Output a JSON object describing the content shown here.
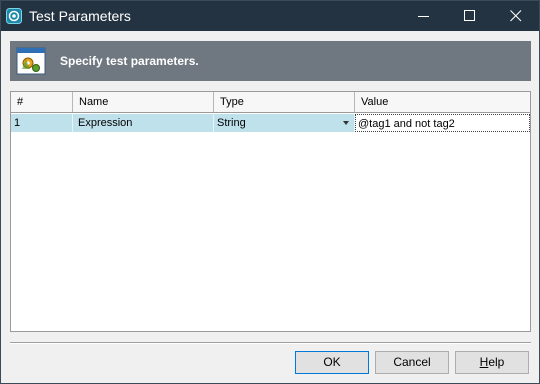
{
  "window": {
    "title": "Test Parameters"
  },
  "titlebar_controls": {
    "minimize_icon": "minimize-icon",
    "maximize_icon": "maximize-icon",
    "close_icon": "close-icon"
  },
  "banner": {
    "text": "Specify test parameters.",
    "icon": "parameters-icon"
  },
  "grid": {
    "columns": [
      "#",
      "Name",
      "Type",
      "Value"
    ],
    "rows": [
      {
        "num": "1",
        "name": "Expression",
        "type": "String",
        "value": "@tag1 and not tag2"
      }
    ]
  },
  "buttons": {
    "ok": "OK",
    "cancel": "Cancel",
    "help_first": "H",
    "help_rest": "elp"
  },
  "colors": {
    "titlebar": "#243342",
    "banner": "#6f7880",
    "row_highlight": "#bfe1eb",
    "ok_border": "#0078d7"
  }
}
